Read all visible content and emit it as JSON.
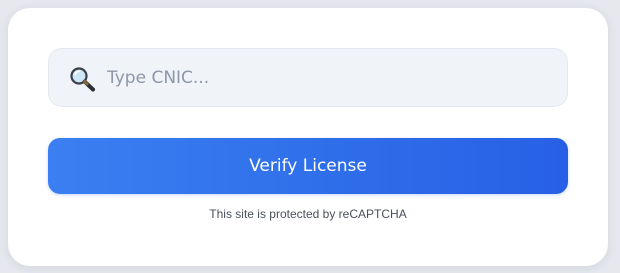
{
  "search": {
    "placeholder": "Type CNIC...",
    "value": "",
    "icon": "magnifying-glass-icon"
  },
  "verify": {
    "label": "Verify License"
  },
  "footer": {
    "recaptcha_text": "This site is protected by reCAPTCHA"
  },
  "colors": {
    "accent": "#2f6ee9",
    "card_background": "#ffffff",
    "input_background": "#f0f3f8"
  }
}
